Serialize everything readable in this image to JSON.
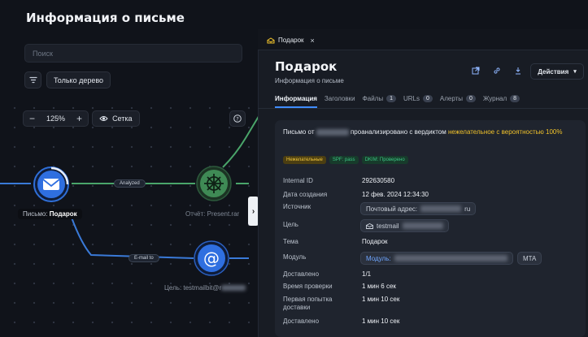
{
  "page": {
    "title": "Информация о письме"
  },
  "search": {
    "placeholder": "Поиск"
  },
  "toolbar": {
    "tree_only_label": "Только дерево"
  },
  "zoom": {
    "minus": "−",
    "level": "125%",
    "plus": "+",
    "grid_label": "Сетка"
  },
  "graph": {
    "mail_node_prefix": "Письмо:",
    "mail_node_name": "Подарок",
    "file_node_label": "Отчёт: Present.rar",
    "target_node_label": "Цель: testmailbit@r",
    "edge_analyzed": "Analyzed",
    "edge_email_to": "E-mail to"
  },
  "tab": {
    "label": "Подарок",
    "close": "×"
  },
  "detail": {
    "title": "Подарок",
    "subtitle": "Информация о письме",
    "actions_label": "Действия",
    "tabs": [
      {
        "label": "Информация",
        "count": ""
      },
      {
        "label": "Заголовки",
        "count": ""
      },
      {
        "label": "Файлы",
        "count": "1"
      },
      {
        "label": "URLs",
        "count": "0"
      },
      {
        "label": "Алерты",
        "count": "0"
      },
      {
        "label": "Журнал",
        "count": "8"
      }
    ],
    "verdict_prefix": "Письмо от",
    "verdict_mid": "проанализировано с вердиктом",
    "verdict_value": "нежелательное с вероятностью 100%",
    "badges": [
      "Нежелательные",
      "SPF: pass",
      "DKIM: Проверено"
    ],
    "fields": {
      "internal_id_label": "Internal ID",
      "internal_id": "292630580",
      "created_label": "Дата создания",
      "created": "12 фев. 2024 12:34:30",
      "source_label": "Источник",
      "source_chip": "Почтовый адрес:",
      "source_suffix": "ru",
      "target_label": "Цель",
      "target_chip": "testmail",
      "subject_label": "Тема",
      "subject": "Подарок",
      "module_label": "Модуль",
      "module_chip": "Модуль:",
      "module_tag": "MTA",
      "delivered_label": "Доставлено",
      "delivered": "1/1",
      "check_time_label": "Время проверки",
      "check_time": "1 мин 6 сек",
      "first_attempt_label": "Первая попытка доставки",
      "first_attempt": "1 мин 10 сек",
      "delivered2_label": "Доставлено",
      "delivered2": "1 мин 10 сек"
    }
  },
  "colors": {
    "accent": "#3f8cff",
    "warning": "#f0c22b",
    "success": "#3cc483",
    "edge_green": "#4aa56a",
    "edge_blue": "#3a7ad8"
  }
}
